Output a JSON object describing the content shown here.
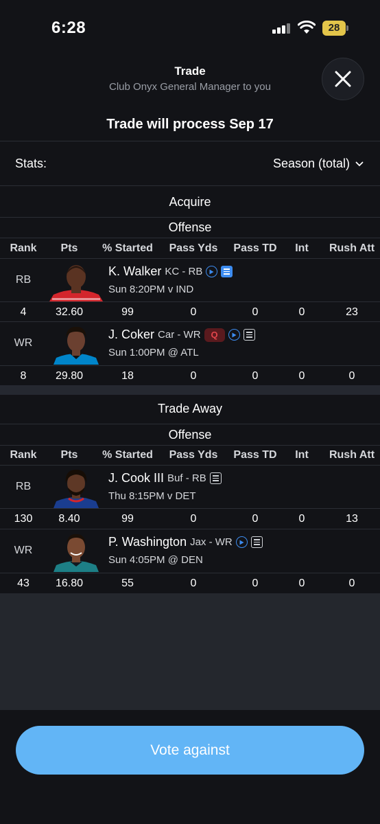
{
  "status_bar": {
    "time": "6:28",
    "battery": "28"
  },
  "header": {
    "title": "Trade",
    "subtitle": "Club Onyx General Manager to you",
    "process_text": "Trade will process Sep 17"
  },
  "stats": {
    "label": "Stats:",
    "selected": "Season (total)"
  },
  "columns": [
    "Rank",
    "Pts",
    "% Started",
    "Pass Yds",
    "Pass TD",
    "Int",
    "Rush Att"
  ],
  "acquire": {
    "title": "Acquire",
    "group": "Offense",
    "players": [
      {
        "pos": "RB",
        "name": "K. Walker",
        "team": "KC - RB",
        "game": "Sun 8:20PM v IND",
        "injury": "",
        "jersey_color": "#d3262c",
        "stats": [
          "4",
          "32.60",
          "99",
          "0",
          "0",
          "0",
          "23"
        ]
      },
      {
        "pos": "WR",
        "name": "J. Coker",
        "team": "Car - WR",
        "game": "Sun 1:00PM @ ATL",
        "injury": "Q",
        "jersey_color": "#0085ca",
        "stats": [
          "8",
          "29.80",
          "18",
          "0",
          "0",
          "0",
          "0"
        ]
      }
    ]
  },
  "trade_away": {
    "title": "Trade Away",
    "group": "Offense",
    "players": [
      {
        "pos": "RB",
        "name": "J. Cook III",
        "team": "Buf - RB",
        "game": "Thu 8:15PM v DET",
        "injury": "",
        "jersey_color": "#1a3d8f",
        "stats": [
          "130",
          "8.40",
          "99",
          "0",
          "0",
          "0",
          "13"
        ]
      },
      {
        "pos": "WR",
        "name": "P. Washington",
        "team": "Jax - WR",
        "game": "Sun 4:05PM @ DEN",
        "injury": "",
        "jersey_color": "#1d7f86",
        "stats": [
          "43",
          "16.80",
          "55",
          "0",
          "0",
          "0",
          "0"
        ]
      }
    ]
  },
  "footer": {
    "vote_label": "Vote against"
  },
  "colors": {
    "accent": "#62b5f6",
    "play_icon": "#3d8cf0",
    "injury_q": "#e2454c",
    "background": "#121317"
  }
}
